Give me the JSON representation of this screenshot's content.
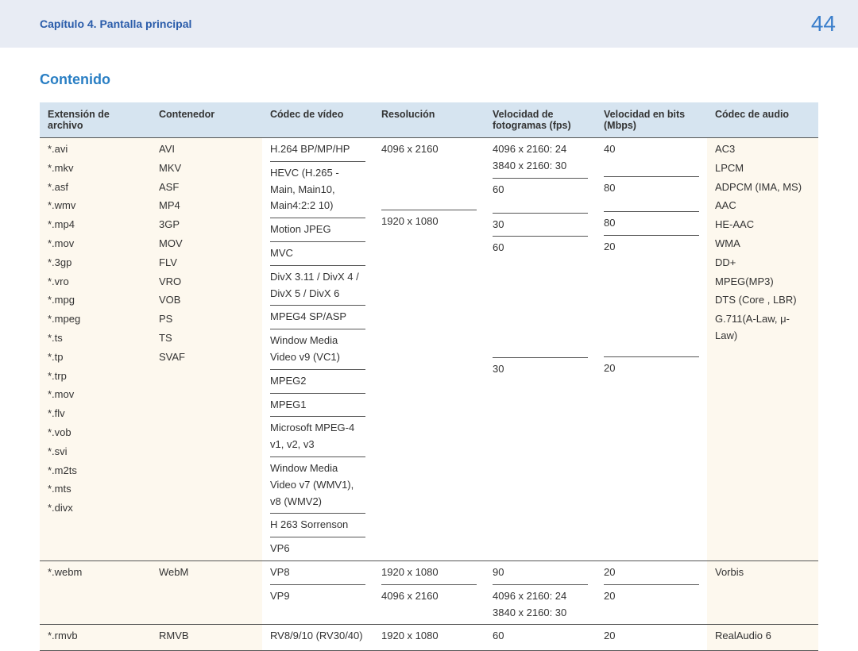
{
  "header": {
    "breadcrumb": "Capítulo 4. Pantalla principal",
    "page_number": "44"
  },
  "section_title": "Contenido",
  "columns": {
    "ext": "Extensión de archivo",
    "cont": "Contenedor",
    "codec": "Códec de vídeo",
    "res": "Resolución",
    "fps": "Velocidad de fotogramas (fps)",
    "mbps": "Velocidad en bits (Mbps)",
    "aud": "Códec de audio"
  },
  "chart_data": {
    "type": "table",
    "rows": [
      {
        "extensions": [
          "*.avi",
          "*.mkv",
          "*.asf",
          "*.wmv",
          "*.mp4",
          "*.mov",
          "*.3gp",
          "*.vro",
          "*.mpg",
          "*.mpeg",
          "*.ts",
          "*.tp",
          "*.trp",
          "*.mov",
          "*.flv",
          "*.vob",
          "*.svi",
          "*.m2ts",
          "*.mts",
          "*.divx"
        ],
        "containers": [
          "AVI",
          "MKV",
          "ASF",
          "MP4",
          "3GP",
          "MOV",
          "FLV",
          "VRO",
          "VOB",
          "PS",
          "TS",
          "SVAF"
        ],
        "codec_rows": [
          {
            "codec": "H.264 BP/MP/HP",
            "res": "4096 x 2160",
            "fps_a": "4096 x 2160: 24",
            "fps_b": "3840 x 2160: 30",
            "mbps": "40"
          },
          {
            "codec": "HEVC (H.265 - Main, Main10, Main4:2:2 10)",
            "res": "",
            "fps_a": "60",
            "fps_b": "",
            "mbps": "80"
          },
          {
            "codec": "Motion JPEG",
            "res": "",
            "fps_a": "30",
            "fps_b": "",
            "mbps": "80"
          },
          {
            "codec": "MVC",
            "res": "1920 x 1080",
            "fps_a": "60",
            "fps_b": "",
            "mbps": "20"
          },
          {
            "codec": "DivX 3.11 / DivX 4 / DivX 5 / DivX 6",
            "res": "",
            "fps_a": "",
            "fps_b": "",
            "mbps": ""
          },
          {
            "codec": "MPEG4 SP/ASP",
            "res": "",
            "fps_a": "",
            "fps_b": "",
            "mbps": ""
          },
          {
            "codec": "Window Media Video v9 (VC1)",
            "res": "",
            "fps_a": "",
            "fps_b": "",
            "mbps": ""
          },
          {
            "codec": "MPEG2",
            "res": "",
            "fps_a": "",
            "fps_b": "",
            "mbps": ""
          },
          {
            "codec": "MPEG1",
            "res": "",
            "fps_a": "",
            "fps_b": "",
            "mbps": ""
          },
          {
            "codec": "Microsoft MPEG-4 v1, v2, v3",
            "res": "",
            "fps_a": "30",
            "fps_b": "",
            "mbps": "20"
          },
          {
            "codec": "Window Media Video v7 (WMV1), v8 (WMV2)",
            "res": "",
            "fps_a": "",
            "fps_b": "",
            "mbps": ""
          },
          {
            "codec": "H 263 Sorrenson",
            "res": "",
            "fps_a": "",
            "fps_b": "",
            "mbps": ""
          },
          {
            "codec": "VP6",
            "res": "",
            "fps_a": "",
            "fps_b": "",
            "mbps": ""
          }
        ],
        "audio": [
          "AC3",
          "LPCM",
          "ADPCM (IMA, MS)",
          "AAC",
          "HE-AAC",
          "WMA",
          "DD+",
          "MPEG(MP3)",
          "DTS (Core , LBR)",
          "G.711(A-Law, μ-Law)"
        ]
      },
      {
        "extensions": [
          "*.webm"
        ],
        "containers": [
          "WebM"
        ],
        "codec_rows": [
          {
            "codec": "VP8",
            "res": "1920 x 1080",
            "fps_a": "90",
            "fps_b": "",
            "mbps": "20"
          },
          {
            "codec": "VP9",
            "res": "4096 x 2160",
            "fps_a": "4096 x 2160: 24",
            "fps_b": "3840 x 2160: 30",
            "mbps": "20"
          }
        ],
        "audio": [
          "Vorbis"
        ]
      },
      {
        "extensions": [
          "*.rmvb"
        ],
        "containers": [
          "RMVB"
        ],
        "codec_rows": [
          {
            "codec": "RV8/9/10 (RV30/40)",
            "res": "1920 x 1080",
            "fps_a": "60",
            "fps_b": "",
            "mbps": "20"
          }
        ],
        "audio": [
          "RealAudio 6"
        ]
      }
    ]
  }
}
